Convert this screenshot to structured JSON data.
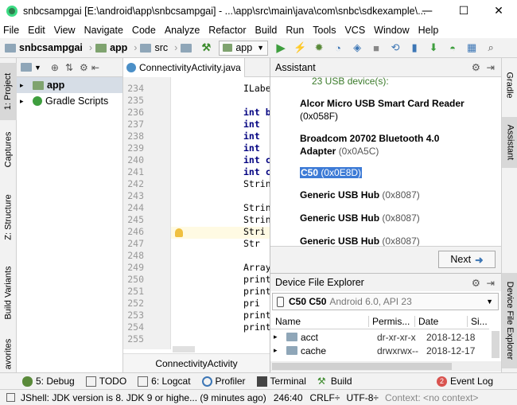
{
  "window": {
    "title": "snbcsampgai [E:\\android\\app\\snbcsampgai] - ...\\app\\src\\main\\java\\com\\snbc\\sdkexample\\...",
    "minimize": "—",
    "maximize": "☐",
    "close": "✕"
  },
  "menu": [
    "File",
    "Edit",
    "View",
    "Navigate",
    "Code",
    "Analyze",
    "Refactor",
    "Build",
    "Run",
    "Tools",
    "VCS",
    "Window",
    "Help"
  ],
  "toolbar": {
    "project": "snbcsampgai",
    "module": "app",
    "src": "src",
    "run_config": "app"
  },
  "left_strip": {
    "project": "1: Project",
    "captures": "Captures",
    "structure": "Z: Structure",
    "build_variants": "Build Variants",
    "favorites": "avorites"
  },
  "project_tree": {
    "items": [
      "app",
      "Gradle Scripts"
    ]
  },
  "editor": {
    "tab": "ConnectivityActivity.java",
    "breadcrumb": "ConnectivityActivity",
    "line_numbers": [
      "234",
      "235",
      "236",
      "237",
      "238",
      "239",
      "240",
      "241",
      "242",
      "243",
      "244",
      "245",
      "246",
      "247",
      "248",
      "249",
      "250",
      "251",
      "252",
      "253",
      "254",
      "255"
    ],
    "code_lines": [
      "ILabe",
      "",
      "int b",
      "int",
      "int",
      "int",
      "int c",
      "int c",
      "Strin",
      "",
      "Strin",
      "Strin",
      "Stri",
      "Str",
      "",
      "Array",
      "print",
      "print",
      "pri",
      "print",
      "print",
      "",
      "",
      ""
    ]
  },
  "assistant": {
    "title": "Assistant",
    "device_count": "23 USB device(s):",
    "devices": [
      {
        "name": "Alcor Micro USB Smart Card Reader",
        "id": "(0x058F)"
      },
      {
        "name": "Broadcom 20702 Bluetooth 4.0",
        "name2": "Adapter",
        "id": "(0x0A5C)"
      },
      {
        "name": "C50",
        "id": "(0x0E8D)"
      },
      {
        "name": "Generic USB Hub",
        "id": "(0x8087)"
      },
      {
        "name": "Generic USB Hub",
        "id": "(0x8087)"
      },
      {
        "name": "Generic USB Hub",
        "id": "(0x8087)"
      }
    ],
    "next_label": "Next"
  },
  "device_explorer": {
    "title": "Device File Explorer",
    "device_bold": "C50 C50",
    "device_info": "Android 6.0, API 23",
    "columns": [
      "Name",
      "Permis...",
      "Date",
      "Si..."
    ],
    "rows": [
      {
        "name": "acct",
        "perm": "dr-xr-xr-x",
        "date": "2018-12-18"
      },
      {
        "name": "cache",
        "perm": "drwxrwx--",
        "date": "2018-12-17"
      }
    ]
  },
  "right_strip": {
    "gradle": "Gradle",
    "assistant": "Assistant",
    "dfe": "Device File Explorer"
  },
  "bottom_tabs": [
    "5: Debug",
    "TODO",
    "6: Logcat",
    "Profiler",
    "Terminal",
    "Build"
  ],
  "event_log": {
    "count": "2",
    "label": "Event Log"
  },
  "status": {
    "message": "JShell: JDK version is 8. JDK 9 or highe... (9 minutes ago)",
    "position": "246:40",
    "line_sep": "CRLF÷",
    "encoding": "UTF-8÷",
    "context": "Context: <no context>"
  }
}
